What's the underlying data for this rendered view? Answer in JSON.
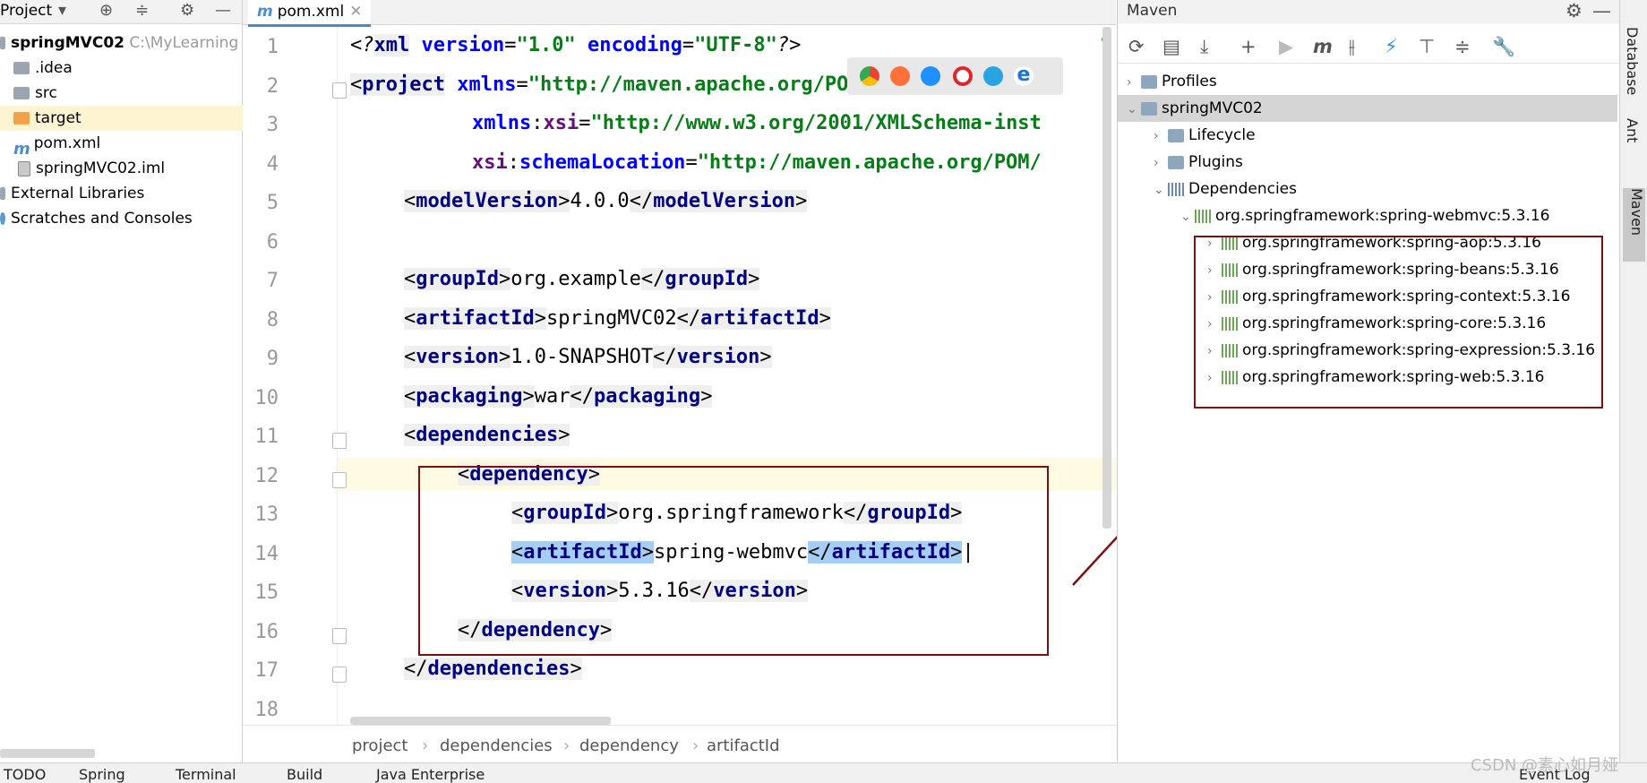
{
  "project_panel": {
    "title": "Project",
    "tree": [
      {
        "label": "springMVC02",
        "hint": "C:\\MyLearning",
        "bold": true
      },
      {
        "label": ".idea"
      },
      {
        "label": "src"
      },
      {
        "label": "target"
      },
      {
        "label": "pom.xml"
      },
      {
        "label": "springMVC02.iml"
      },
      {
        "label": "External Libraries"
      },
      {
        "label": "Scratches and Consoles"
      }
    ]
  },
  "editor": {
    "tab_label": "pom.xml",
    "line_numbers": [
      "1",
      "2",
      "3",
      "4",
      "5",
      "6",
      "7",
      "8",
      "9",
      "10",
      "11",
      "12",
      "13",
      "14",
      "15",
      "16",
      "17",
      "18"
    ],
    "code": {
      "l1": {
        "pi_open": "<?",
        "name": "xml",
        "a1": " version",
        "v1": "\"1.0\"",
        "a2": " encoding",
        "v2": "\"UTF-8\"",
        "pi_close": "?>"
      },
      "l2": {
        "tag": "project",
        "attr": "xmlns",
        "val": "\"http://maven.apache.org/POM/4.0.0\""
      },
      "l3": {
        "ns": "xmlns",
        "attr": "xsi",
        "val": "\"http://www.w3.org/2001/XMLSchema-inst"
      },
      "l4": {
        "ns": "xsi",
        "attr": "schemaLocation",
        "val": "\"http://maven.apache.org/POM/"
      },
      "l5": {
        "tag": "modelVersion",
        "text": "4.0.0"
      },
      "l7": {
        "tag": "groupId",
        "text": "org.example"
      },
      "l8": {
        "tag": "artifactId",
        "text": "springMVC02"
      },
      "l9": {
        "tag": "version",
        "text": "1.0-SNAPSHOT"
      },
      "l10": {
        "tag": "packaging",
        "text": "war"
      },
      "l11": {
        "tag": "dependencies"
      },
      "l12": {
        "tag": "dependency"
      },
      "l13": {
        "tag": "groupId",
        "text": "org.springframework"
      },
      "l14": {
        "tag": "artifactId",
        "text": "spring-webmvc"
      },
      "l15": {
        "tag": "version",
        "text": "5.3.16"
      },
      "l16": {
        "tag": "dependency"
      },
      "l17": {
        "tag": "dependencies"
      }
    },
    "breadcrumb": [
      "project",
      "dependencies",
      "dependency",
      "artifactId"
    ]
  },
  "maven_panel": {
    "title": "Maven",
    "tree": {
      "profiles": "Profiles",
      "project": "springMVC02",
      "lifecycle": "Lifecycle",
      "plugins": "Plugins",
      "dependencies": "Dependencies",
      "root_dep": "org.springframework:spring-webmvc:5.3.16",
      "children": [
        "org.springframework:spring-aop:5.3.16",
        "org.springframework:spring-beans:5.3.16",
        "org.springframework:spring-context:5.3.16",
        "org.springframework:spring-core:5.3.16",
        "org.springframework:spring-expression:5.3.16",
        "org.springframework:spring-web:5.3.16"
      ]
    }
  },
  "right_strip": {
    "tabs": [
      "Database",
      "Ant",
      "Maven"
    ]
  },
  "bottom_bar": {
    "items": [
      "TODO",
      "Spring",
      "Terminal",
      "Build",
      "Java Enterprise",
      "Event Log"
    ]
  },
  "watermark": "CSDN @素心如月娅",
  "colors": {
    "accent": "#4a88c7",
    "highlight_box": "#7a1010",
    "selection": "#a6cdf4"
  }
}
